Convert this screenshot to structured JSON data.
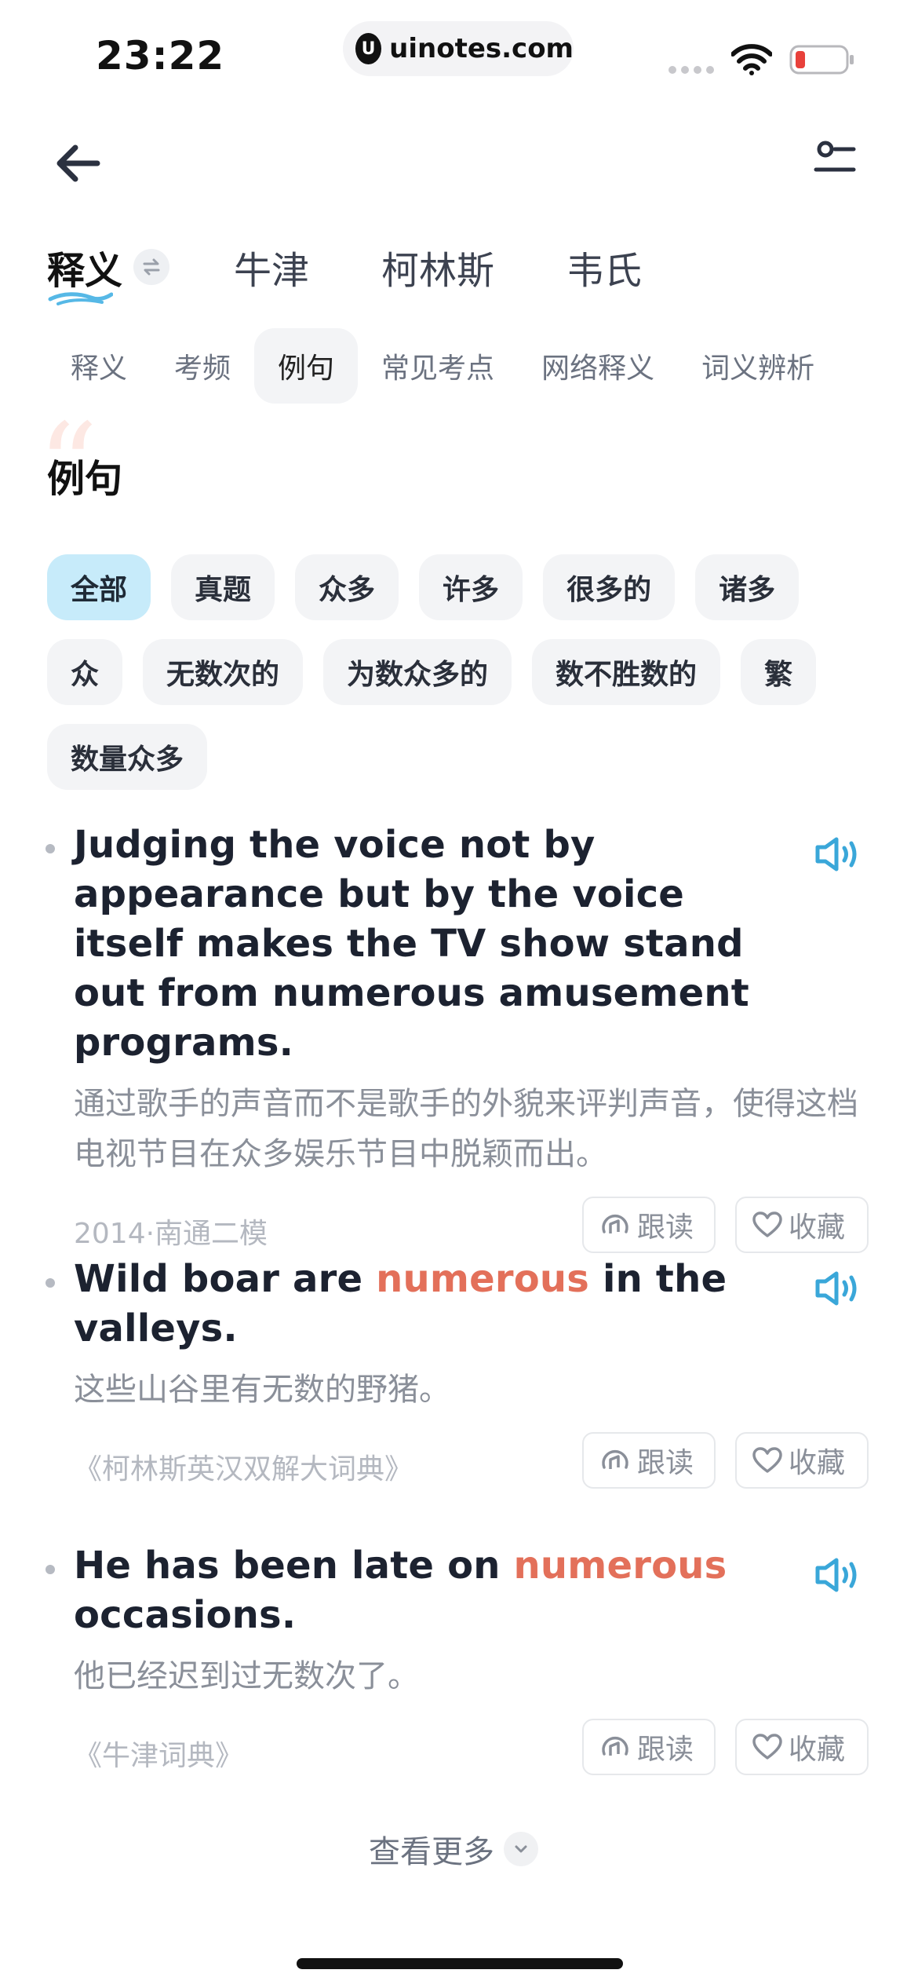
{
  "status": {
    "time": "23:22",
    "url": "uinotes.com",
    "url_logo": "U"
  },
  "dict_tabs": [
    {
      "label": "释义",
      "active": true
    },
    {
      "label": "牛津"
    },
    {
      "label": "柯林斯"
    },
    {
      "label": "韦氏"
    }
  ],
  "section_tabs": [
    {
      "label": "释义"
    },
    {
      "label": "考频"
    },
    {
      "label": "例句",
      "active": true
    },
    {
      "label": "常见考点"
    },
    {
      "label": "网络释义"
    },
    {
      "label": "词义辨析"
    }
  ],
  "section": {
    "title": "例句",
    "quote_glyph": "“"
  },
  "chips": [
    {
      "label": "全部",
      "active": true
    },
    {
      "label": "真题"
    },
    {
      "label": "众多"
    },
    {
      "label": "许多"
    },
    {
      "label": "很多的"
    },
    {
      "label": "诸多"
    },
    {
      "label": "众"
    },
    {
      "label": "无数次的"
    },
    {
      "label": "为数众多的"
    },
    {
      "label": "数不胜数的"
    },
    {
      "label": "繁"
    },
    {
      "label": "数量众多"
    }
  ],
  "sentences": [
    {
      "en_before": "Judging the voice not by appearance but by the voice itself makes the TV show stand out from numerous amusement programs.",
      "en_highlight": "",
      "en_after": "",
      "zh": "通过歌手的声音而不是歌手的外貌来评判声音，使得这档电视节目在众多娱乐节目中脱颖而出。",
      "source": "2014·南通二模"
    },
    {
      "en_before": "Wild boar are ",
      "en_highlight": "numerous",
      "en_after": " in the valleys.",
      "zh": "这些山谷里有无数的野猪。",
      "source": "《柯林斯英汉双解大词典》"
    },
    {
      "en_before": "He has been late on ",
      "en_highlight": "numerous",
      "en_after": " occasions.",
      "zh": "他已经迟到过无数次了。",
      "source": "《牛津词典》"
    }
  ],
  "actions": {
    "follow_label": "跟读",
    "favorite_label": "收藏"
  },
  "more_label": "查看更多",
  "colors": {
    "highlight": "#e3705a",
    "accent_blue": "#3aa7d9",
    "chip_active_bg": "#c7ebfa"
  },
  "icons": {
    "back": "arrow-left-icon",
    "settings": "settings-sliders-icon",
    "swap": "swap-arrows-icon",
    "speaker": "speaker-icon",
    "follow": "follow-read-icon",
    "favorite": "heart-icon",
    "more": "chevron-down-icon"
  }
}
